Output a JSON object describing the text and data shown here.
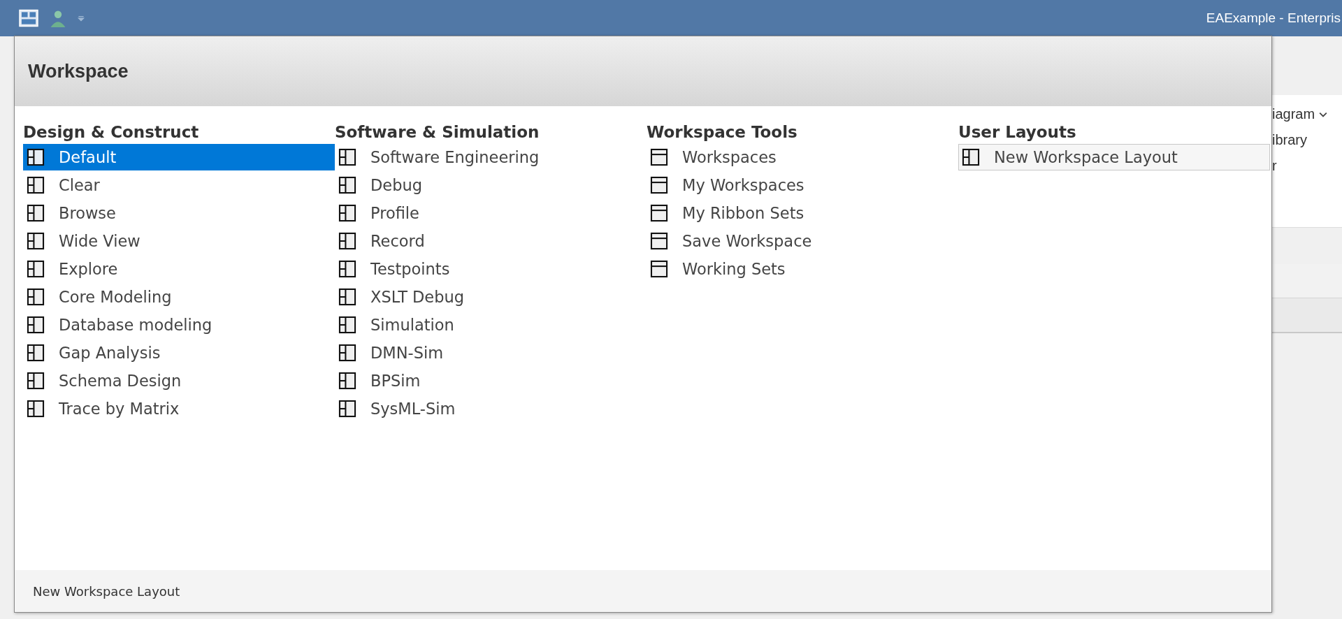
{
  "title_bar": {
    "title": "EAExample - Enterpris"
  },
  "ribbon": {
    "texts": [
      "iagram",
      "ibrary",
      "r"
    ]
  },
  "popup": {
    "title": "Workspace",
    "columns": [
      {
        "heading": "Design & Construct",
        "items": [
          {
            "label": "Default",
            "kind": "layout",
            "selected": true
          },
          {
            "label": "Clear",
            "kind": "layout",
            "selected": false
          },
          {
            "label": "Browse",
            "kind": "layout",
            "selected": false
          },
          {
            "label": "Wide View",
            "kind": "layout",
            "selected": false
          },
          {
            "label": "Explore",
            "kind": "layout",
            "selected": false
          },
          {
            "label": "Core Modeling",
            "kind": "layout",
            "selected": false
          },
          {
            "label": "Database modeling",
            "kind": "layout",
            "selected": false
          },
          {
            "label": "Gap Analysis",
            "kind": "layout",
            "selected": false
          },
          {
            "label": "Schema Design",
            "kind": "layout",
            "selected": false
          },
          {
            "label": "Trace by Matrix",
            "kind": "layout",
            "selected": false
          }
        ]
      },
      {
        "heading": "Software & Simulation",
        "items": [
          {
            "label": "Software Engineering",
            "kind": "layout",
            "selected": false
          },
          {
            "label": "Debug",
            "kind": "layout",
            "selected": false
          },
          {
            "label": "Profile",
            "kind": "layout",
            "selected": false
          },
          {
            "label": "Record",
            "kind": "layout",
            "selected": false
          },
          {
            "label": "Testpoints",
            "kind": "layout",
            "selected": false
          },
          {
            "label": "XSLT Debug",
            "kind": "layout",
            "selected": false
          },
          {
            "label": "Simulation",
            "kind": "layout",
            "selected": false
          },
          {
            "label": "DMN-Sim",
            "kind": "layout",
            "selected": false
          },
          {
            "label": "BPSim",
            "kind": "layout",
            "selected": false
          },
          {
            "label": "SysML-Sim",
            "kind": "layout",
            "selected": false
          }
        ]
      },
      {
        "heading": "Workspace Tools",
        "items": [
          {
            "label": "Workspaces",
            "kind": "tool",
            "selected": false
          },
          {
            "label": "My Workspaces",
            "kind": "tool",
            "selected": false
          },
          {
            "label": "My Ribbon Sets",
            "kind": "tool",
            "selected": false
          },
          {
            "label": "Save Workspace",
            "kind": "tool",
            "selected": false
          },
          {
            "label": "Working Sets",
            "kind": "tool",
            "selected": false
          }
        ]
      },
      {
        "heading": "User Layouts",
        "items": [
          {
            "label": "New Workspace Layout",
            "kind": "layout",
            "selected": false,
            "focused": true
          }
        ]
      }
    ],
    "footer": "New Workspace Layout"
  }
}
